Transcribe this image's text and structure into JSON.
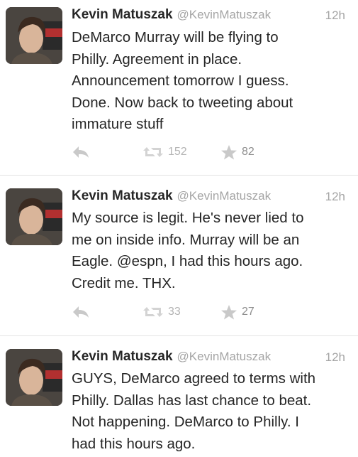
{
  "tweets": [
    {
      "name": "Kevin Matuszak",
      "handle": "@KevinMatuszak",
      "time": "12h",
      "text": "DeMarco Murray will be flying to\nPhilly. Agreement in place.\nAnnouncement tomorrow I guess.\nDone. Now back to tweeting about\nimmature stuff",
      "retweets": "152",
      "favorites": "82"
    },
    {
      "name": "Kevin Matuszak",
      "handle": "@KevinMatuszak",
      "time": "12h",
      "text": "My source is legit. He's never lied to\nme on inside info. Murray will be an\nEagle. @espn, I had this hours ago.\nCredit me. THX.",
      "retweets": "33",
      "favorites": "27"
    },
    {
      "name": "Kevin Matuszak",
      "handle": "@KevinMatuszak",
      "time": "12h",
      "text": "GUYS, DeMarco agreed to terms with\nPhilly. Dallas has last chance to beat.\nNot happening. DeMarco to Philly. I\nhad this hours ago."
    }
  ],
  "icons": {
    "reply": "reply-arrow-icon",
    "retweet": "retweet-icon",
    "favorite": "star-icon"
  },
  "colors": {
    "icon": "#c9c9c9",
    "muted": "#a5a5a5",
    "text": "#262626"
  }
}
